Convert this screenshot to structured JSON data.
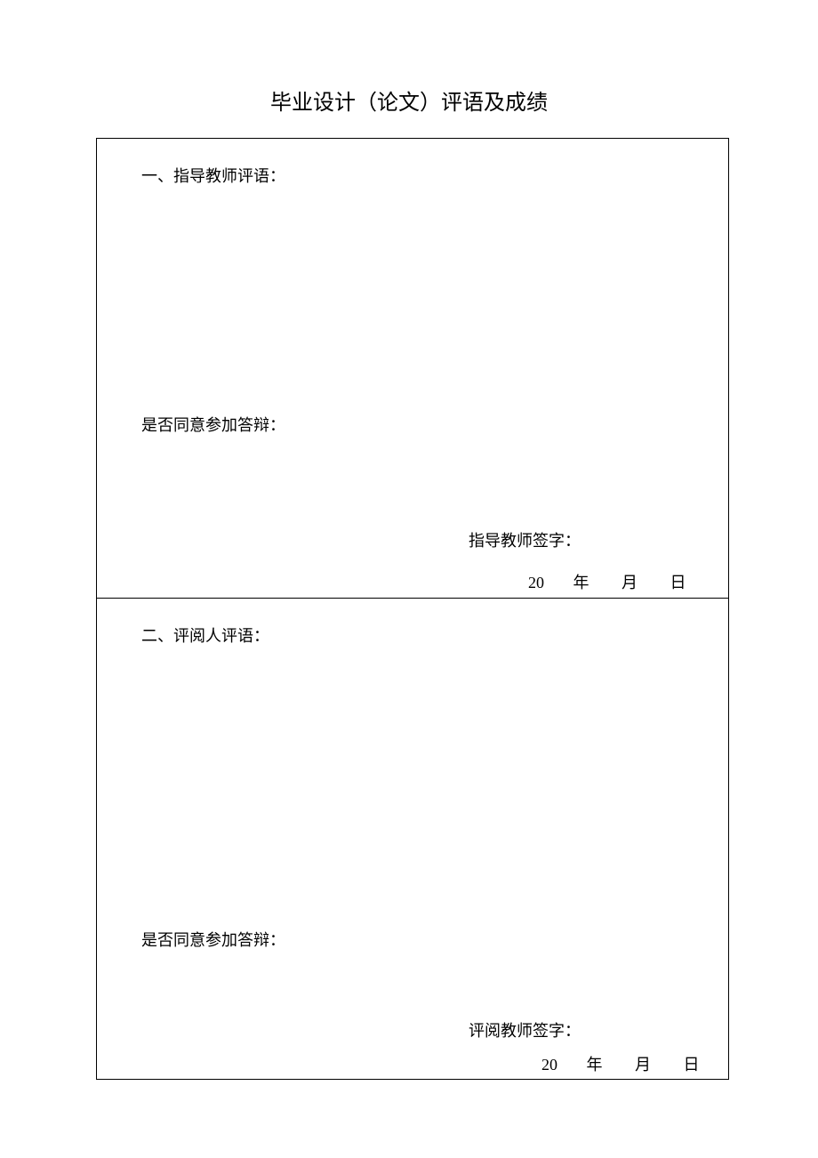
{
  "page": {
    "title": "毕业设计（论文）评语及成绩"
  },
  "section1": {
    "heading": "一、指导教师评语：",
    "agree_label": "是否同意参加答辩：",
    "signature_label": "指导教师签字：",
    "date": {
      "prefix": "20",
      "year": "年",
      "month": "月",
      "day": "日"
    }
  },
  "section2": {
    "heading": "二、评阅人评语：",
    "agree_label": "是否同意参加答辩：",
    "signature_label": "评阅教师签字：",
    "date": {
      "prefix": "20",
      "year": "年",
      "month": "月",
      "day": "日"
    }
  }
}
